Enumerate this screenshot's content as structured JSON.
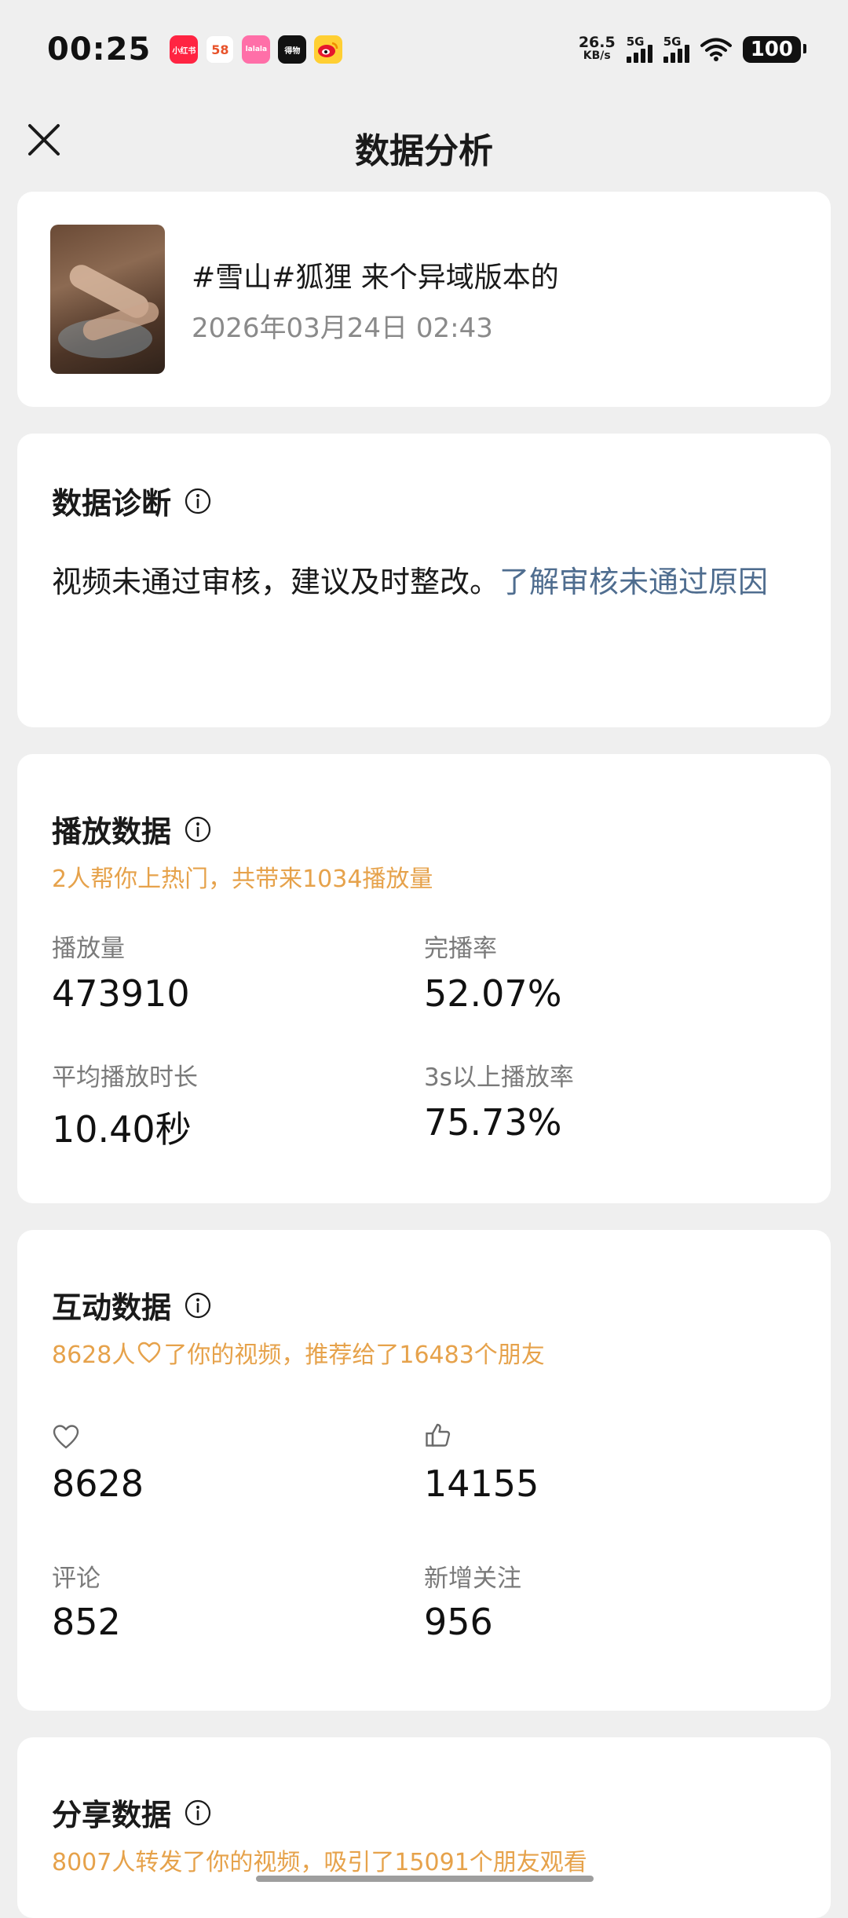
{
  "status_bar": {
    "time": "00:25",
    "notification_icons": [
      {
        "name": "xiaohongshu-icon",
        "label": "小红书",
        "color": "#ff2442"
      },
      {
        "name": "58-icon",
        "label": "58",
        "color": "#ffffff"
      },
      {
        "name": "app-pink-icon",
        "label": "lalala",
        "color": "#ff6fa8"
      },
      {
        "name": "dewu-icon",
        "label": "得物",
        "color": "#111111"
      },
      {
        "name": "weibo-icon",
        "label": "",
        "color": "#ffb300"
      }
    ],
    "net_speed_value": "26.5",
    "net_speed_unit": "KB/s",
    "signal1_label": "5G",
    "signal2_label": "5G",
    "battery": "100"
  },
  "header": {
    "title": "数据分析"
  },
  "video": {
    "title": "#雪山#狐狸 来个异域版本的",
    "date": "2026年03月24日 02:43"
  },
  "diagnosis": {
    "title": "数据诊断",
    "text": "视频未通过审核，建议及时整改。",
    "link": "了解审核未通过原因"
  },
  "play_data": {
    "title": "播放数据",
    "summary": "2人帮你上热门，共带来1034播放量",
    "metrics": [
      {
        "label": "播放量",
        "value": "473910"
      },
      {
        "label": "完播率",
        "value": "52.07%"
      },
      {
        "label": "平均播放时长",
        "value": "10.40秒"
      },
      {
        "label": "3s以上播放率",
        "value": "75.73%"
      }
    ]
  },
  "interaction_data": {
    "title": "互动数据",
    "summary_prefix": "8628人",
    "summary_suffix": "了你的视频，推荐给了16483个朋友",
    "metrics": [
      {
        "icon": "heart-icon",
        "value": "8628"
      },
      {
        "icon": "thumbs-up-icon",
        "value": "14155"
      },
      {
        "label": "评论",
        "value": "852"
      },
      {
        "label": "新增关注",
        "value": "956"
      }
    ]
  },
  "share_data": {
    "title": "分享数据",
    "summary": "8007人转发了你的视频，吸引了15091个朋友观看"
  },
  "colors": {
    "accent_orange": "#e6a24b",
    "link_blue": "#4f6d8f",
    "background": "#efefef"
  }
}
